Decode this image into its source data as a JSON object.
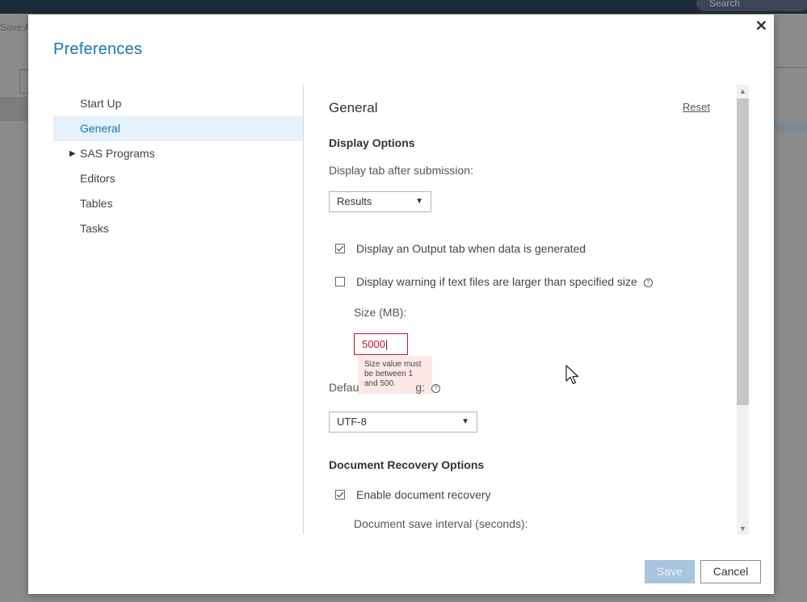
{
  "background": {
    "search_placeholder": "Search",
    "save_as_fragment": "Save A"
  },
  "dialog": {
    "title": "Preferences",
    "close_glyph": "✕"
  },
  "nav": {
    "items": [
      {
        "label": "Start Up",
        "selected": false
      },
      {
        "label": "General",
        "selected": true
      },
      {
        "label": "SAS Programs",
        "selected": false,
        "expandable": true
      },
      {
        "label": "Editors",
        "selected": false
      },
      {
        "label": "Tables",
        "selected": false
      },
      {
        "label": "Tasks",
        "selected": false
      }
    ]
  },
  "general": {
    "heading": "General",
    "reset_label": "Reset",
    "display_options": {
      "heading": "Display Options",
      "tab_after_label": "Display tab after submission:",
      "tab_after_value": "Results",
      "output_tab_label": "Display an Output tab when data is generated",
      "output_tab_checked": true,
      "warning_label": "Display warning if text files are larger than specified size",
      "warning_checked": false,
      "size_label": "Size (MB):",
      "size_value": "5000",
      "size_error": "Size value must be between 1 and 500.",
      "encoding_label_visible": "Defau",
      "encoding_label_tail": "g:",
      "encoding_value": "UTF-8"
    },
    "recovery": {
      "heading": "Document Recovery Options",
      "enable_label": "Enable document recovery",
      "enable_checked": true,
      "interval_label": "Document save interval (seconds):"
    }
  },
  "buttons": {
    "save": "Save",
    "cancel": "Cancel"
  },
  "colors": {
    "accent": "#1a73b5",
    "nav_selected_bg": "#e5f2fb",
    "error": "#c8102e",
    "error_bg": "#fde8e8",
    "save_disabled": "#a9c5de"
  }
}
